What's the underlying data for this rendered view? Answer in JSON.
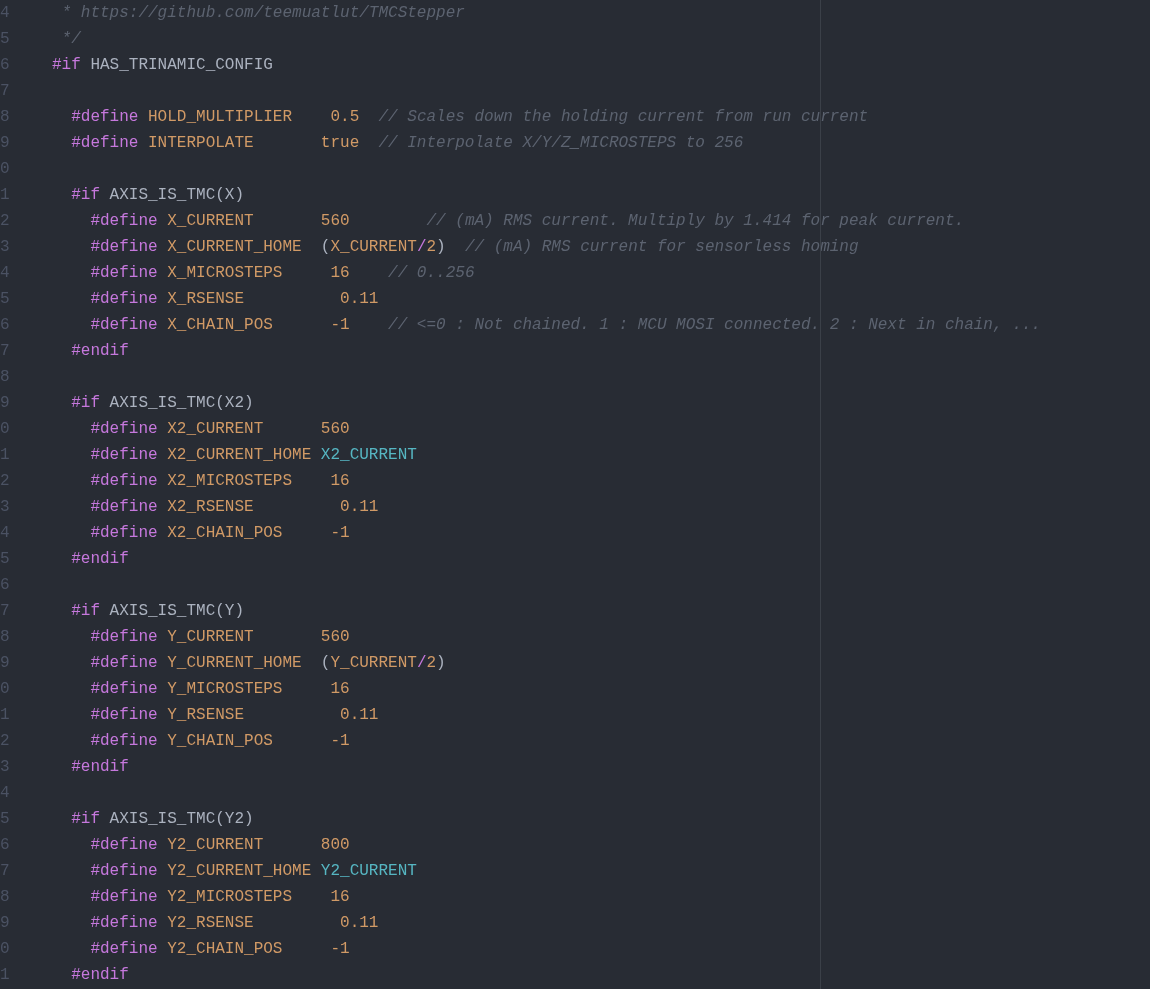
{
  "editor": {
    "lines": [
      {
        "number": "4",
        "tokens": [
          {
            "kind": "comment",
            "text": " * https://github.com/teemuatlut/TMCStepper"
          }
        ]
      },
      {
        "number": "5",
        "tokens": [
          {
            "kind": "comment",
            "text": " */"
          }
        ]
      },
      {
        "number": "6",
        "tokens": [
          {
            "kind": "directive",
            "text": "#if "
          },
          {
            "kind": "plain",
            "text": "HAS_TRINAMIC_CONFIG"
          }
        ]
      },
      {
        "number": "7"
      },
      {
        "number": "8",
        "tokens": [
          {
            "kind": "directive",
            "text": "  #define "
          },
          {
            "kind": "macro",
            "text": "HOLD_MULTIPLIER    "
          },
          {
            "kind": "number",
            "text": "0.5  "
          },
          {
            "kind": "comment",
            "text": "// Scales down the holding current from run current"
          }
        ]
      },
      {
        "number": "9",
        "tokens": [
          {
            "kind": "directive",
            "text": "  #define "
          },
          {
            "kind": "macro",
            "text": "INTERPOLATE       "
          },
          {
            "kind": "number",
            "text": "true  "
          },
          {
            "kind": "comment",
            "text": "// Interpolate X/Y/Z_MICROSTEPS to 256"
          }
        ]
      },
      {
        "number": "0"
      },
      {
        "number": "1",
        "tokens": [
          {
            "kind": "directive",
            "text": "  #if "
          },
          {
            "kind": "plain",
            "text": "AXIS_IS_TMC(X)"
          }
        ]
      },
      {
        "number": "2",
        "tokens": [
          {
            "kind": "directive",
            "text": "    #define "
          },
          {
            "kind": "macro",
            "text": "X_CURRENT       "
          },
          {
            "kind": "number",
            "text": "560        "
          },
          {
            "kind": "comment",
            "text": "// (mA) RMS current. Multiply by 1.414 for peak current."
          }
        ]
      },
      {
        "number": "3",
        "tokens": [
          {
            "kind": "directive",
            "text": "    #define "
          },
          {
            "kind": "macro",
            "text": "X_CURRENT_HOME  "
          },
          {
            "kind": "plain",
            "text": "("
          },
          {
            "kind": "macro",
            "text": "X_CURRENT"
          },
          {
            "kind": "operator",
            "text": "/"
          },
          {
            "kind": "number",
            "text": "2"
          },
          {
            "kind": "plain",
            "text": ")  "
          },
          {
            "kind": "comment",
            "text": "// (mA) RMS current for sensorless homing"
          }
        ]
      },
      {
        "number": "4",
        "tokens": [
          {
            "kind": "directive",
            "text": "    #define "
          },
          {
            "kind": "macro",
            "text": "X_MICROSTEPS     "
          },
          {
            "kind": "number",
            "text": "16    "
          },
          {
            "kind": "comment",
            "text": "// 0..256"
          }
        ]
      },
      {
        "number": "5",
        "tokens": [
          {
            "kind": "directive",
            "text": "    #define "
          },
          {
            "kind": "macro",
            "text": "X_RSENSE          "
          },
          {
            "kind": "number",
            "text": "0.11"
          }
        ]
      },
      {
        "number": "6",
        "tokens": [
          {
            "kind": "directive",
            "text": "    #define "
          },
          {
            "kind": "macro",
            "text": "X_CHAIN_POS      "
          },
          {
            "kind": "number",
            "text": "-1    "
          },
          {
            "kind": "comment",
            "text": "// <=0 : Not chained. 1 : MCU MOSI connected. 2 : Next in chain, ..."
          }
        ]
      },
      {
        "number": "7",
        "tokens": [
          {
            "kind": "directive",
            "text": "  #endif"
          }
        ]
      },
      {
        "number": "8"
      },
      {
        "number": "9",
        "tokens": [
          {
            "kind": "directive",
            "text": "  #if "
          },
          {
            "kind": "plain",
            "text": "AXIS_IS_TMC(X2)"
          }
        ]
      },
      {
        "number": "0",
        "tokens": [
          {
            "kind": "directive",
            "text": "    #define "
          },
          {
            "kind": "macro",
            "text": "X2_CURRENT      "
          },
          {
            "kind": "number",
            "text": "560"
          }
        ]
      },
      {
        "number": "1",
        "tokens": [
          {
            "kind": "directive",
            "text": "    #define "
          },
          {
            "kind": "macro",
            "text": "X2_CURRENT_HOME "
          },
          {
            "kind": "ref",
            "text": "X2_CURRENT"
          }
        ]
      },
      {
        "number": "2",
        "tokens": [
          {
            "kind": "directive",
            "text": "    #define "
          },
          {
            "kind": "macro",
            "text": "X2_MICROSTEPS    "
          },
          {
            "kind": "number",
            "text": "16"
          }
        ]
      },
      {
        "number": "3",
        "tokens": [
          {
            "kind": "directive",
            "text": "    #define "
          },
          {
            "kind": "macro",
            "text": "X2_RSENSE         "
          },
          {
            "kind": "number",
            "text": "0.11"
          }
        ]
      },
      {
        "number": "4",
        "tokens": [
          {
            "kind": "directive",
            "text": "    #define "
          },
          {
            "kind": "macro",
            "text": "X2_CHAIN_POS     "
          },
          {
            "kind": "number",
            "text": "-1"
          }
        ]
      },
      {
        "number": "5",
        "tokens": [
          {
            "kind": "directive",
            "text": "  #endif"
          }
        ]
      },
      {
        "number": "6"
      },
      {
        "number": "7",
        "tokens": [
          {
            "kind": "directive",
            "text": "  #if "
          },
          {
            "kind": "plain",
            "text": "AXIS_IS_TMC(Y)"
          }
        ]
      },
      {
        "number": "8",
        "tokens": [
          {
            "kind": "directive",
            "text": "    #define "
          },
          {
            "kind": "macro",
            "text": "Y_CURRENT       "
          },
          {
            "kind": "number",
            "text": "560"
          }
        ]
      },
      {
        "number": "9",
        "tokens": [
          {
            "kind": "directive",
            "text": "    #define "
          },
          {
            "kind": "macro",
            "text": "Y_CURRENT_HOME  "
          },
          {
            "kind": "plain",
            "text": "("
          },
          {
            "kind": "macro",
            "text": "Y_CURRENT"
          },
          {
            "kind": "operator",
            "text": "/"
          },
          {
            "kind": "number",
            "text": "2"
          },
          {
            "kind": "plain",
            "text": ")"
          }
        ]
      },
      {
        "number": "0",
        "tokens": [
          {
            "kind": "directive",
            "text": "    #define "
          },
          {
            "kind": "macro",
            "text": "Y_MICROSTEPS     "
          },
          {
            "kind": "number",
            "text": "16"
          }
        ]
      },
      {
        "number": "1",
        "tokens": [
          {
            "kind": "directive",
            "text": "    #define "
          },
          {
            "kind": "macro",
            "text": "Y_RSENSE          "
          },
          {
            "kind": "number",
            "text": "0.11"
          }
        ]
      },
      {
        "number": "2",
        "tokens": [
          {
            "kind": "directive",
            "text": "    #define "
          },
          {
            "kind": "macro",
            "text": "Y_CHAIN_POS      "
          },
          {
            "kind": "number",
            "text": "-1"
          }
        ]
      },
      {
        "number": "3",
        "tokens": [
          {
            "kind": "directive",
            "text": "  #endif"
          }
        ]
      },
      {
        "number": "4"
      },
      {
        "number": "5",
        "tokens": [
          {
            "kind": "directive",
            "text": "  #if "
          },
          {
            "kind": "plain",
            "text": "AXIS_IS_TMC(Y2)"
          }
        ]
      },
      {
        "number": "6",
        "tokens": [
          {
            "kind": "directive",
            "text": "    #define "
          },
          {
            "kind": "macro",
            "text": "Y2_CURRENT      "
          },
          {
            "kind": "number",
            "text": "800"
          }
        ]
      },
      {
        "number": "7",
        "tokens": [
          {
            "kind": "directive",
            "text": "    #define "
          },
          {
            "kind": "macro",
            "text": "Y2_CURRENT_HOME "
          },
          {
            "kind": "ref",
            "text": "Y2_CURRENT"
          }
        ]
      },
      {
        "number": "8",
        "tokens": [
          {
            "kind": "directive",
            "text": "    #define "
          },
          {
            "kind": "macro",
            "text": "Y2_MICROSTEPS    "
          },
          {
            "kind": "number",
            "text": "16"
          }
        ]
      },
      {
        "number": "9",
        "tokens": [
          {
            "kind": "directive",
            "text": "    #define "
          },
          {
            "kind": "macro",
            "text": "Y2_RSENSE         "
          },
          {
            "kind": "number",
            "text": "0.11"
          }
        ]
      },
      {
        "number": "0",
        "tokens": [
          {
            "kind": "directive",
            "text": "    #define "
          },
          {
            "kind": "macro",
            "text": "Y2_CHAIN_POS     "
          },
          {
            "kind": "number",
            "text": "-1"
          }
        ]
      },
      {
        "number": "1",
        "tokens": [
          {
            "kind": "directive",
            "text": "  #endif"
          }
        ]
      }
    ]
  }
}
